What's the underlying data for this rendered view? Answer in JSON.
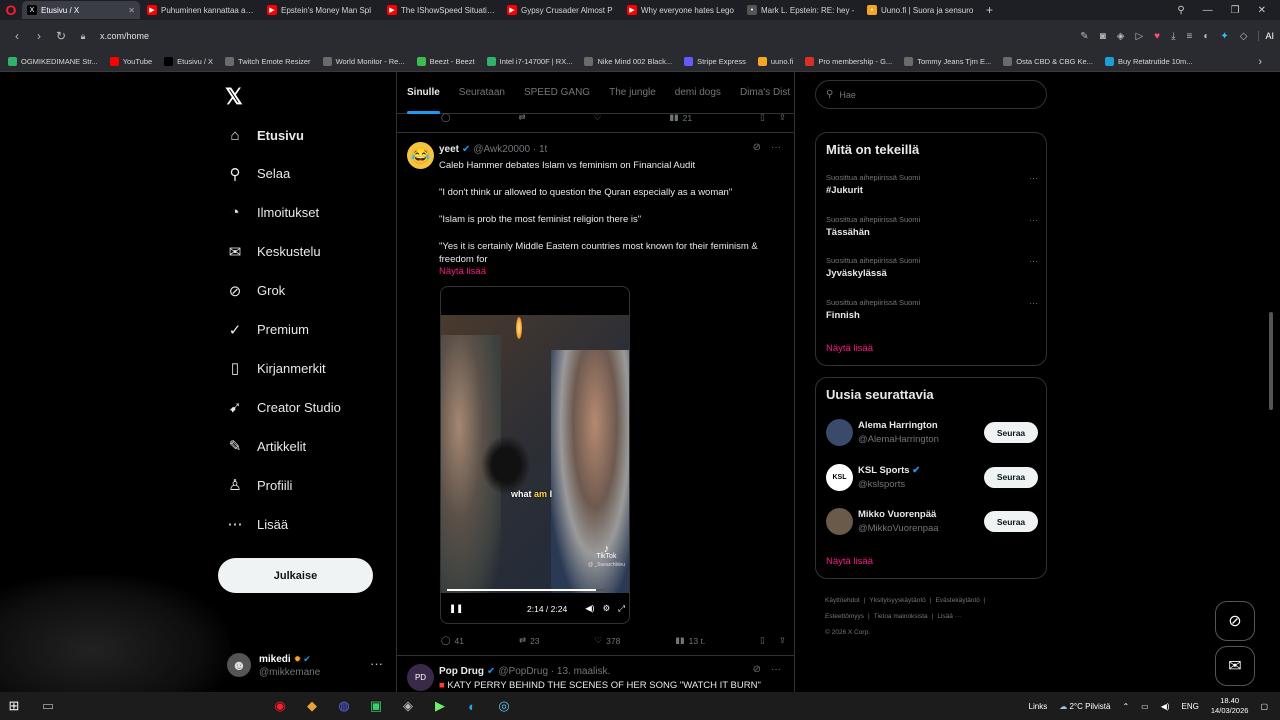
{
  "browser": {
    "tabs": [
      {
        "label": "Etusivu / X",
        "icon": "x-icon",
        "active": true,
        "color": "#000000"
      },
      {
        "label": "Puhuminen kannattaa aina",
        "icon": "youtube-icon",
        "color": "#ff0000"
      },
      {
        "label": "Epstein's Money Man Spl",
        "icon": "youtube-icon",
        "color": "#ff0000"
      },
      {
        "label": "The IShowSpeed Situation",
        "icon": "youtube-icon",
        "color": "#ff0000"
      },
      {
        "label": "Gypsy Crusader Almost P",
        "icon": "youtube-icon",
        "color": "#ff0000"
      },
      {
        "label": "Why everyone hates Lego",
        "icon": "youtube-icon",
        "color": "#ff0000"
      },
      {
        "label": "Mark L. Epstein: RE: hey -",
        "icon": "gmail-icon",
        "color": "#555555"
      },
      {
        "label": "Uuno.fi | Suora ja sensuro",
        "icon": "uuno-icon",
        "color": "#f5a623"
      }
    ],
    "url": "x.com/home",
    "ai_label": "AI",
    "bookmarks": [
      {
        "label": "OGMIKEDIMANE Str...",
        "color": "#2fb36b"
      },
      {
        "label": "YouTube",
        "color": "#ff0000"
      },
      {
        "label": "Etusivu / X",
        "color": "#000000"
      },
      {
        "label": "Twitch Emote Resizer",
        "color": "#6b6b6b"
      },
      {
        "label": "World Monitor - Re...",
        "color": "#6b6b6b"
      },
      {
        "label": "Beezt - Beezt",
        "color": "#3dbb4f"
      },
      {
        "label": "Intel i7-14700F | RX...",
        "color": "#2fb36b"
      },
      {
        "label": "Nike Mind 002 Black...",
        "color": "#6b6b6b"
      },
      {
        "label": "Stripe Express",
        "color": "#635bff"
      },
      {
        "label": "uuno.fi",
        "color": "#f5a623"
      },
      {
        "label": "Pro membership - G...",
        "color": "#d93025"
      },
      {
        "label": "Tommy Jeans Tjm E...",
        "color": "#6b6b6b"
      },
      {
        "label": "Osta CBD & CBG Ke...",
        "color": "#6b6b6b"
      },
      {
        "label": "Buy Retatrutide 10m...",
        "color": "#1a9fd6"
      }
    ]
  },
  "nav": {
    "items": [
      {
        "label": "Etusivu",
        "icon": "home-icon",
        "glyph": "⌂"
      },
      {
        "label": "Selaa",
        "icon": "search-icon",
        "glyph": "⚲"
      },
      {
        "label": "Ilmoitukset",
        "icon": "bell-icon",
        "glyph": "◔"
      },
      {
        "label": "Keskustelu",
        "icon": "mail-icon",
        "glyph": "✉"
      },
      {
        "label": "Grok",
        "icon": "grok-icon",
        "glyph": "⊘"
      },
      {
        "label": "Premium",
        "icon": "premium-icon",
        "glyph": "✓"
      },
      {
        "label": "Kirjanmerkit",
        "icon": "bookmark-icon",
        "glyph": "▯"
      },
      {
        "label": "Creator Studio",
        "icon": "rocket-icon",
        "glyph": "➹"
      },
      {
        "label": "Artikkelit",
        "icon": "article-icon",
        "glyph": "✎"
      },
      {
        "label": "Profiili",
        "icon": "profile-icon",
        "glyph": "♙"
      },
      {
        "label": "Lisää",
        "icon": "more-icon",
        "glyph": "⋯"
      }
    ],
    "post_button": "Julkaise",
    "account": {
      "name": "mikedi",
      "handle": "@mikkemane"
    }
  },
  "feed": {
    "tabs": [
      "Sinulle",
      "Seurataan",
      "SPEED GANG",
      "The jungle",
      "demi dogs",
      "Dima's Dist"
    ],
    "prev_actions": {
      "views": "21"
    },
    "tweet": {
      "name": "yeet",
      "handle": "@Awk20000",
      "time": "1t",
      "lines": [
        "Caleb Hammer debates Islam vs feminism on Financial Audit",
        "\"I don't think ur allowed to question the Quran especially as a woman\"",
        "\"Islam is prob the most feminist religion there is\"",
        "\"Yes it is certainly Middle Eastern countries most known for their feminism & freedom for"
      ],
      "show_more": "Näytä lisää",
      "video": {
        "caption_white": "what",
        "caption_highlight": "am",
        "caption_tail": "I",
        "tiktok_label": "TikTok",
        "tiktok_handle": "@ _Ssearchbleu",
        "time": "2:14 / 2:24",
        "progress": 0.93
      },
      "replies": "41",
      "reposts": "23",
      "likes": "378",
      "views": "13 t."
    },
    "next_tweet": {
      "name": "Pop Drug",
      "handle": "@PopDrug",
      "time": "13. maalisk.",
      "text": "KATY PERRY BEHIND THE SCENES OF HER SONG \"WATCH IT BURN\" OMG"
    }
  },
  "right": {
    "search_placeholder": "Hae",
    "trends_title": "Mitä on tekeillä",
    "trends": [
      {
        "context": "Suosittua aihepiirissä Suomi",
        "topic": "#Jukurit"
      },
      {
        "context": "Suosittua aihepiirissä Suomi",
        "topic": "Tässähän"
      },
      {
        "context": "Suosittua aihepiirissä Suomi",
        "topic": "Jyväskylässä"
      },
      {
        "context": "Suosittua aihepiirissä Suomi",
        "topic": "Finnish"
      }
    ],
    "trends_more": "Näytä lisää",
    "who_title": "Uusia seurattavia",
    "who": [
      {
        "name": "Alema Harrington",
        "handle": "@AlemaHarrington",
        "verified": false,
        "follow": "Seuraa"
      },
      {
        "name": "KSL Sports",
        "handle": "@kslsports",
        "verified": true,
        "follow": "Seuraa"
      },
      {
        "name": "Mikko Vuorenpää",
        "handle": "@MikkoVuorenpaa",
        "verified": false,
        "follow": "Seuraa"
      }
    ],
    "who_more": "Näytä lisää",
    "footer": [
      "Käyttöehdot",
      "|",
      "Yksityisyyskäytäntö",
      "|",
      "Evästekäytäntö",
      "|",
      "Esteettömyys",
      "|",
      "Tietoa mainoksista",
      "|",
      "Lisää ···",
      "© 2026 X Corp."
    ]
  },
  "taskbar": {
    "links": "Links",
    "weather": "2°C Pilvistä",
    "lang": "ENG",
    "time": "18.40",
    "date": "14/03/2026"
  }
}
